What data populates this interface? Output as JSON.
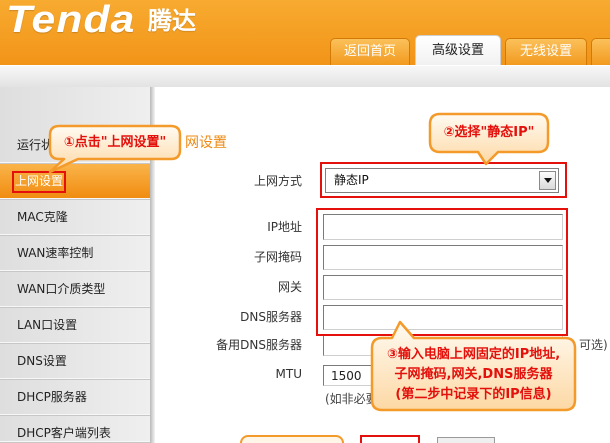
{
  "header": {
    "logo": "Tenda",
    "logo_cn": "腾达",
    "tabs": [
      {
        "label": "返回首页",
        "active": false
      },
      {
        "label": "高级设置",
        "active": true
      },
      {
        "label": "无线设置",
        "active": false
      }
    ]
  },
  "sidebar": {
    "items": [
      {
        "label": "运行状"
      },
      {
        "label": "上网设置",
        "active": true
      },
      {
        "label": "MAC克隆"
      },
      {
        "label": "WAN速率控制"
      },
      {
        "label": "WAN口介质类型"
      },
      {
        "label": "LAN口设置"
      },
      {
        "label": "DNS设置"
      },
      {
        "label": "DHCP服务器"
      },
      {
        "label": "DHCP客户端列表"
      }
    ]
  },
  "main": {
    "title": "网设置",
    "form": {
      "mode": {
        "label": "上网方式",
        "value": "静态IP"
      },
      "ip": {
        "label": "IP地址"
      },
      "mask": {
        "label": "子网掩码"
      },
      "gateway": {
        "label": "网关"
      },
      "dns": {
        "label": "DNS服务器"
      },
      "dns2": {
        "label": "备用DNS服务器",
        "hint": "可选)"
      },
      "mtu": {
        "label": "MTU",
        "value": "1500",
        "hint": "(如非必要"
      }
    }
  },
  "callouts": [
    {
      "text": "①点击\"上网设置\""
    },
    {
      "text": "②选择\"静态IP\""
    },
    {
      "lines": [
        "③输入电脑上网固定的IP地址,",
        "子网掩码,网关,DNS服务器",
        "(第二步中记录下的IP信息)"
      ]
    }
  ],
  "colors": {
    "header_orange": "#f29418",
    "title_orange": "#ee8a12",
    "highlight_red": "#e3100c",
    "callout_border": "#f39a2a",
    "callout_text": "#e3100c"
  }
}
